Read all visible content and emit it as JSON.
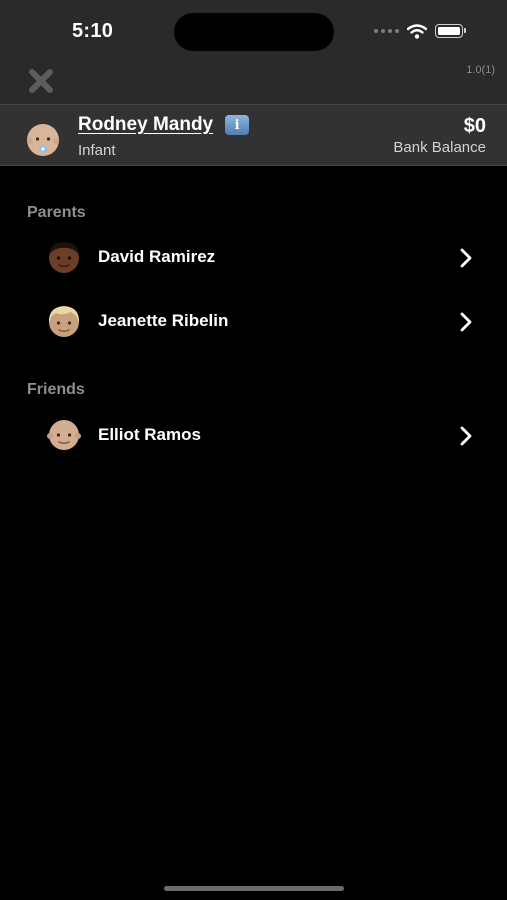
{
  "status_bar": {
    "time": "5:10"
  },
  "header": {
    "version": "1.0(1)"
  },
  "profile": {
    "name": "Rodney Mandy",
    "info_glyph": "i",
    "role": "Infant",
    "balance": "$0",
    "balance_label": "Bank Balance"
  },
  "sections": {
    "parents": {
      "title": "Parents",
      "items": [
        {
          "name": "David Ramirez",
          "icon": "dark-skin-avatar-icon"
        },
        {
          "name": "Jeanette Ribelin",
          "icon": "blonde-avatar-icon"
        }
      ]
    },
    "friends": {
      "title": "Friends",
      "items": [
        {
          "name": "Elliot Ramos",
          "icon": "bald-avatar-icon"
        }
      ]
    }
  },
  "colors": {
    "background": "#000000",
    "header_bg": "#2a2a2a",
    "profile_bg": "#323232",
    "section_text": "#8e8e93",
    "info_blue": "#5f8fc5"
  }
}
